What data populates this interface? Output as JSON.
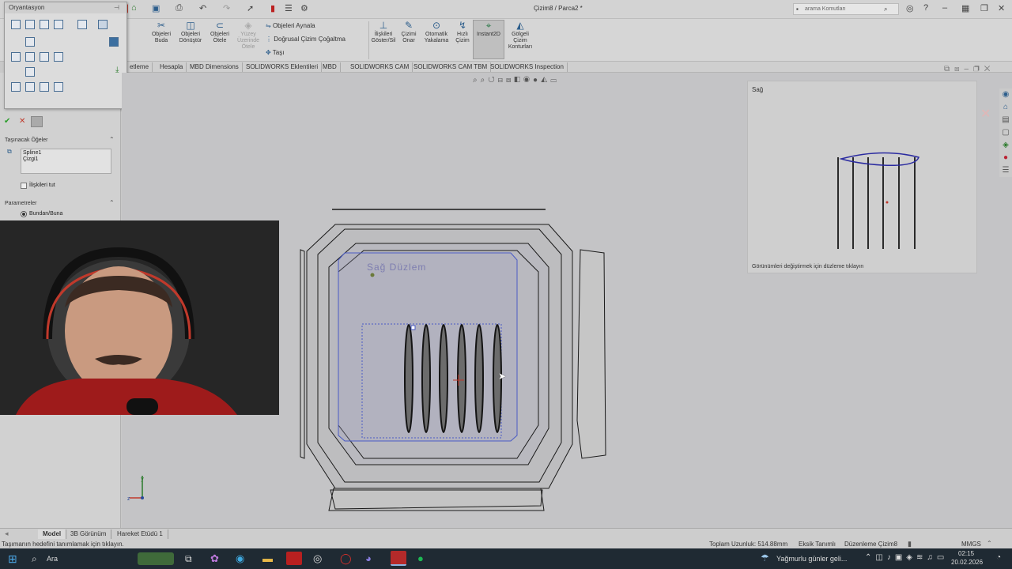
{
  "window": {
    "title": "Çizim8 / Parca2 *",
    "search_placeholder": "arama Komutları"
  },
  "orientation": {
    "title": "Oryantasyon"
  },
  "ribbon": {
    "buda": "Objeleri\nBuda",
    "donustur": "Objeleri\nDönüştür",
    "otele": "Objeleri\nÖtele",
    "yuzey": "Yüzey\nÜzerinde\nÖtele",
    "aynala": "Objeleri Aynala",
    "dogrusal": "Doğrusal Çizim Çoğaltma",
    "tasi": "Taşı",
    "iliskiler": "İlişkileri\nGöster/Sil",
    "onar": "Çizimi\nOnar",
    "otomatik": "Otomatik\nYakalama",
    "hizli": "Hızlı\nÇizim",
    "instant": "Instant2D",
    "golgeli": "Gölgeli\nÇizim\nKonturları"
  },
  "tabs": [
    "etleme",
    "Hesapla",
    "MBD Dimensions",
    "SOLIDWORKS Eklentileri",
    "MBD",
    "SOLIDWORKS CAM",
    "SOLIDWORKS CAM TBM",
    "SOLIDWORKS Inspection"
  ],
  "left_panel": {
    "section_items": "Taşınacak Öğeler",
    "items": [
      "Spline1",
      "Çizgi1"
    ],
    "keep_relations": "İlişkileri tut",
    "section_params": "Parametreler",
    "from_to": "Bundan/Buna"
  },
  "viewport": {
    "plane_label": "Sağ Düzlem"
  },
  "preview": {
    "title": "Sağ",
    "hint": "Görünümleri değiştirmek için düzleme tıklayın"
  },
  "bottom_tabs": [
    "Model",
    "3B Görünüm",
    "Hareket Etüdü 1"
  ],
  "status": {
    "message": "Taşımanın hedefini tanımlamak için tıklayın.",
    "length": "Toplam Uzunluk: 514.88mm",
    "defined": "Eksik Tanımlı",
    "editing": "Düzenleme Çizim8",
    "units": "MMGS"
  },
  "taskbar": {
    "search": "Ara",
    "weather": "Yağmurlu günler geli...",
    "time": "02:15",
    "date": "20.02.2026"
  },
  "colors": {
    "accent": "#2d5e8c",
    "sketch": "#4a5bc4"
  }
}
